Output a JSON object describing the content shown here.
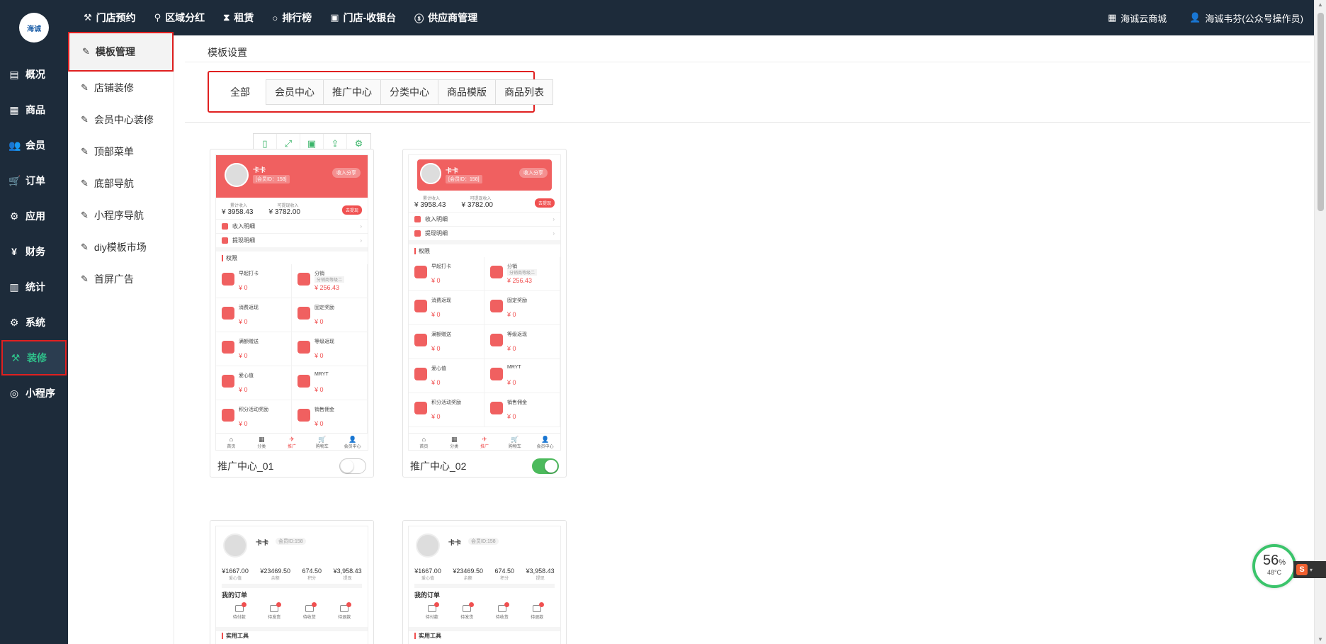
{
  "topnav": [
    {
      "icon": "⚒",
      "label": "门店预约"
    },
    {
      "icon": "⚲",
      "label": "区域分红"
    },
    {
      "icon": "⧗",
      "label": "租赁"
    },
    {
      "icon": "○",
      "label": "排行榜"
    },
    {
      "icon": "▣",
      "label": "门店-收银台"
    },
    {
      "icon": "ⓢ",
      "label": "供应商管理"
    }
  ],
  "topright": {
    "shop": "海诚云商城",
    "user": "海诚韦芬(公众号操作员)"
  },
  "logo_text": "海诚",
  "sidebar": [
    {
      "icon": "▤",
      "label": "概况"
    },
    {
      "icon": "▦",
      "label": "商品"
    },
    {
      "icon": "👥",
      "label": "会员"
    },
    {
      "icon": "🛒",
      "label": "订单"
    },
    {
      "icon": "⚙",
      "label": "应用"
    },
    {
      "icon": "¥",
      "label": "财务"
    },
    {
      "icon": "▥",
      "label": "统计"
    },
    {
      "icon": "⚙",
      "label": "系统"
    },
    {
      "icon": "⚒",
      "label": "装修"
    },
    {
      "icon": "◎",
      "label": "小程序"
    }
  ],
  "subsidebar": [
    {
      "label": "模板管理"
    },
    {
      "label": "店铺装修"
    },
    {
      "label": "会员中心装修"
    },
    {
      "label": "顶部菜单"
    },
    {
      "label": "底部导航"
    },
    {
      "label": "小程序导航"
    },
    {
      "label": "diy模板市场"
    },
    {
      "label": "首屏广告"
    }
  ],
  "breadcrumb": "模板设置",
  "tabs": [
    "全部",
    "会员中心",
    "推广中心",
    "分类中心",
    "商品模版",
    "商品列表"
  ],
  "phone": {
    "name": "卡卡",
    "member_id": "[会员ID：158]",
    "member_id_short": "会员ID:158",
    "share": "收入分享",
    "earn_total": "¥ 3958.43",
    "earn_total_label": "累计收入",
    "earn_withdraw": "¥ 3782.00",
    "earn_withdraw_label": "可提现收入",
    "withdraw_btn": "去提现",
    "row1": "收入明细",
    "row2": "提现明细",
    "section": "权限",
    "grid": [
      {
        "t": "早起打卡",
        "v": "¥ 0"
      },
      {
        "t": "分销",
        "s": "分销商等级二",
        "v": "¥ 256.43"
      },
      {
        "t": "消费返现",
        "v": "¥ 0"
      },
      {
        "t": "固定奖励",
        "v": "¥ 0"
      },
      {
        "t": "满额赠送",
        "v": "¥ 0"
      },
      {
        "t": "等级返现",
        "v": "¥ 0"
      },
      {
        "t": "爱心值",
        "v": "¥ 0"
      },
      {
        "t": "MRYT",
        "v": "¥ 0"
      },
      {
        "t": "积分活动奖励",
        "v": "¥ 0"
      },
      {
        "t": "销售佣金",
        "v": "¥ 0"
      }
    ],
    "tabbar": [
      "首页",
      "分类",
      "推广",
      "购物车",
      "会员中心"
    ]
  },
  "phone2": {
    "stats": [
      {
        "v": "¥1667.00",
        "l": "爱心值"
      },
      {
        "v": "¥23469.50",
        "l": "余额"
      },
      {
        "v": "674.50",
        "l": "积分"
      },
      {
        "v": "¥3,958.43",
        "l": "提现"
      }
    ],
    "orders_title": "我的订单",
    "orders": [
      "待付款",
      "待发货",
      "待收货",
      "待退款"
    ],
    "tools_title": "实用工具"
  },
  "cards": [
    {
      "title": "推广中心_01",
      "enabled": false
    },
    {
      "title": "推广中心_02",
      "enabled": true
    }
  ],
  "widget": {
    "pct": "56",
    "pct_unit": "%",
    "temp": "48°C"
  },
  "ime": {
    "label": "S"
  }
}
